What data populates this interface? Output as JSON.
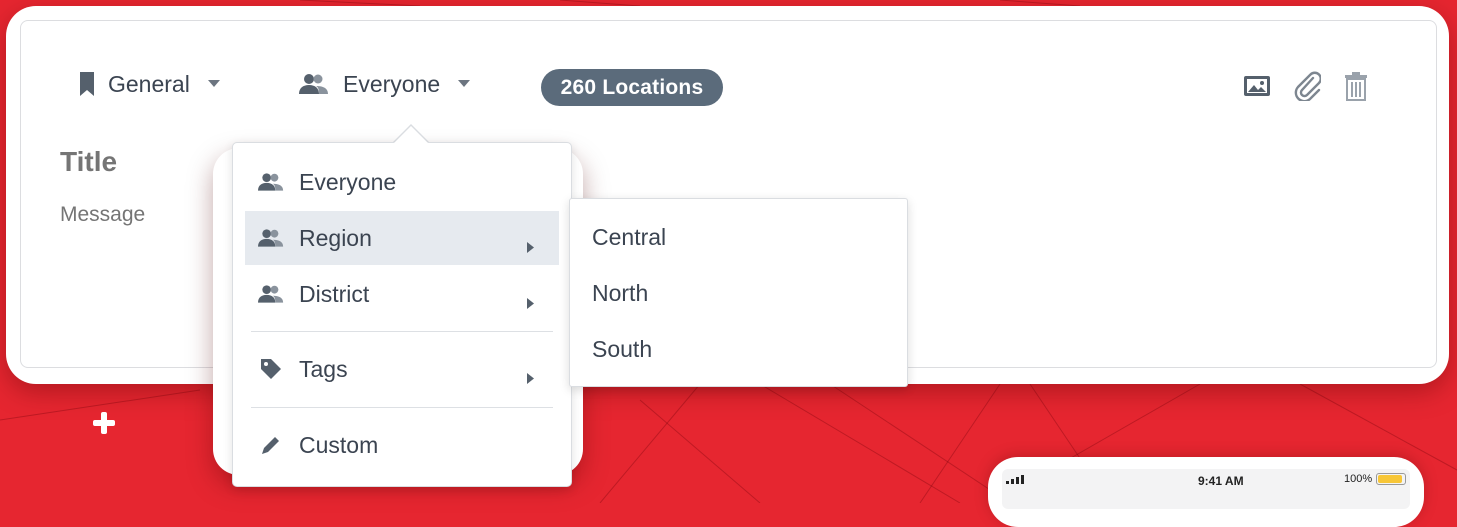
{
  "colors": {
    "background": "#e62630",
    "text": "#3b4451",
    "badge": "#5b6b7b",
    "placeholder": "#c3c7cc",
    "active_row": "#e6eaef"
  },
  "toolbar": {
    "category": {
      "label": "General",
      "icon": "bookmark-icon"
    },
    "audience": {
      "label": "Everyone",
      "icon": "people-icon"
    },
    "locations_badge": "260 Locations",
    "actions": [
      "image-icon",
      "paperclip-icon",
      "trash-icon"
    ]
  },
  "composer": {
    "title_placeholder": "Title",
    "message_placeholder": "Message"
  },
  "audience_menu": {
    "items": [
      {
        "label": "Everyone",
        "icon": "people-icon",
        "has_submenu": false
      },
      {
        "label": "Region",
        "icon": "people-icon",
        "has_submenu": true,
        "active": true
      },
      {
        "label": "District",
        "icon": "people-icon",
        "has_submenu": true
      },
      {
        "label": "Tags",
        "icon": "tag-icon",
        "has_submenu": true
      },
      {
        "label": "Custom",
        "icon": "pencil-icon",
        "has_submenu": false
      }
    ]
  },
  "region_submenu": {
    "items": [
      "Central",
      "North",
      "South"
    ]
  },
  "phone_preview": {
    "time": "9:41 AM",
    "battery": "100%"
  }
}
